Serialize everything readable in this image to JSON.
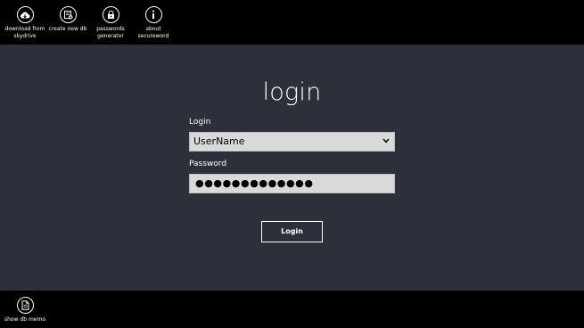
{
  "top_bar": {
    "buttons": [
      {
        "id": "download",
        "label": "download from\nskydrive",
        "icon": "cloud-download-icon"
      },
      {
        "id": "create",
        "label": "create new db",
        "icon": "new-database-icon"
      },
      {
        "id": "generator",
        "label": "passwords\ngenerator",
        "icon": "password-generator-icon"
      },
      {
        "id": "about",
        "label": "about\nsecureword",
        "icon": "info-icon"
      }
    ]
  },
  "main": {
    "title": "login",
    "login_label": "Login",
    "login_value": "UserName",
    "password_label": "Password",
    "password_mask": "●●●●●●●●●●●●●",
    "login_button": "Login"
  },
  "bottom_bar": {
    "buttons": [
      {
        "id": "memo",
        "label": "show db memo",
        "icon": "memo-document-icon"
      }
    ]
  },
  "colors": {
    "bar_background": "#000000",
    "page_background": "#2c303a",
    "field_background": "#d9d9d9",
    "text": "#ffffff"
  }
}
